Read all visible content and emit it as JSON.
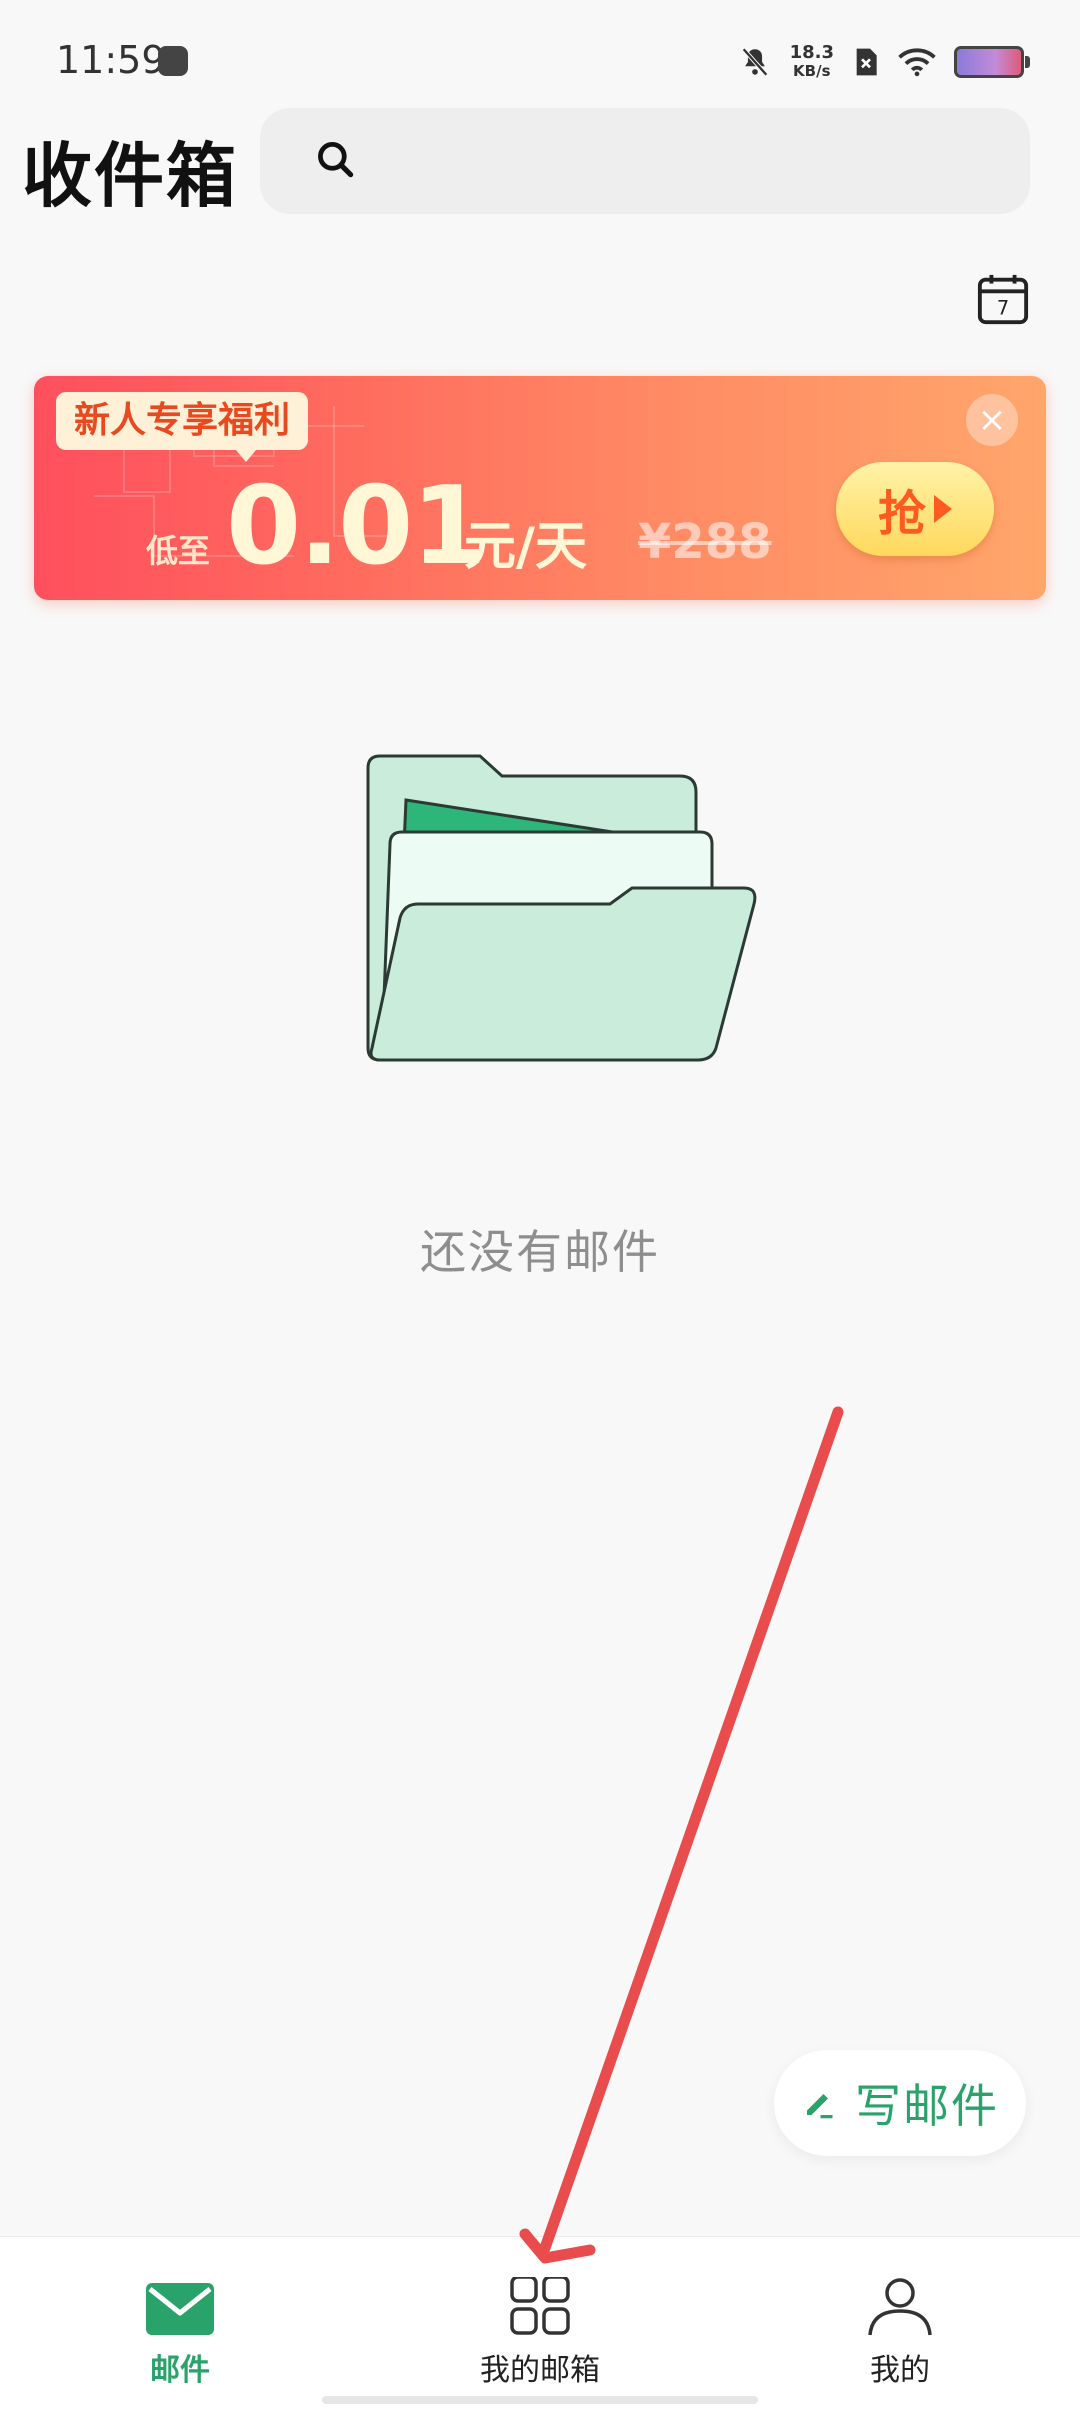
{
  "status_bar": {
    "time": "11:59",
    "net_speed_value": "18.3",
    "net_speed_unit": "KB/s",
    "icons": [
      "shopping-bag-icon",
      "mute-bell-icon",
      "sim-off-icon",
      "wifi-icon",
      "battery-icon"
    ]
  },
  "header": {
    "title": "收件箱",
    "search_icon": "search-icon",
    "calendar_day": "7"
  },
  "promo": {
    "tag": "新人专享福利",
    "prefix": "低至",
    "price": "0.01",
    "unit": "元/天",
    "original_price": "¥288",
    "grab_label": "抢",
    "close_glyph": "×",
    "colors": {
      "start": "#ff4f5e",
      "end": "#ffa66b",
      "price": "#fff7d6"
    }
  },
  "empty_state": {
    "text": "还没有邮件",
    "illustration": "empty-folder-illustration"
  },
  "compose": {
    "label": "写邮件",
    "icon": "pencil-icon"
  },
  "bottom_nav": {
    "items": [
      {
        "label": "邮件",
        "icon": "mail-icon",
        "active": true
      },
      {
        "label": "我的邮箱",
        "icon": "grid-icon",
        "active": false
      },
      {
        "label": "我的",
        "icon": "person-icon",
        "active": false
      }
    ]
  },
  "colors": {
    "accent": "#29a36a",
    "annotation": "#e84c4c",
    "background": "#f8f8f8"
  }
}
